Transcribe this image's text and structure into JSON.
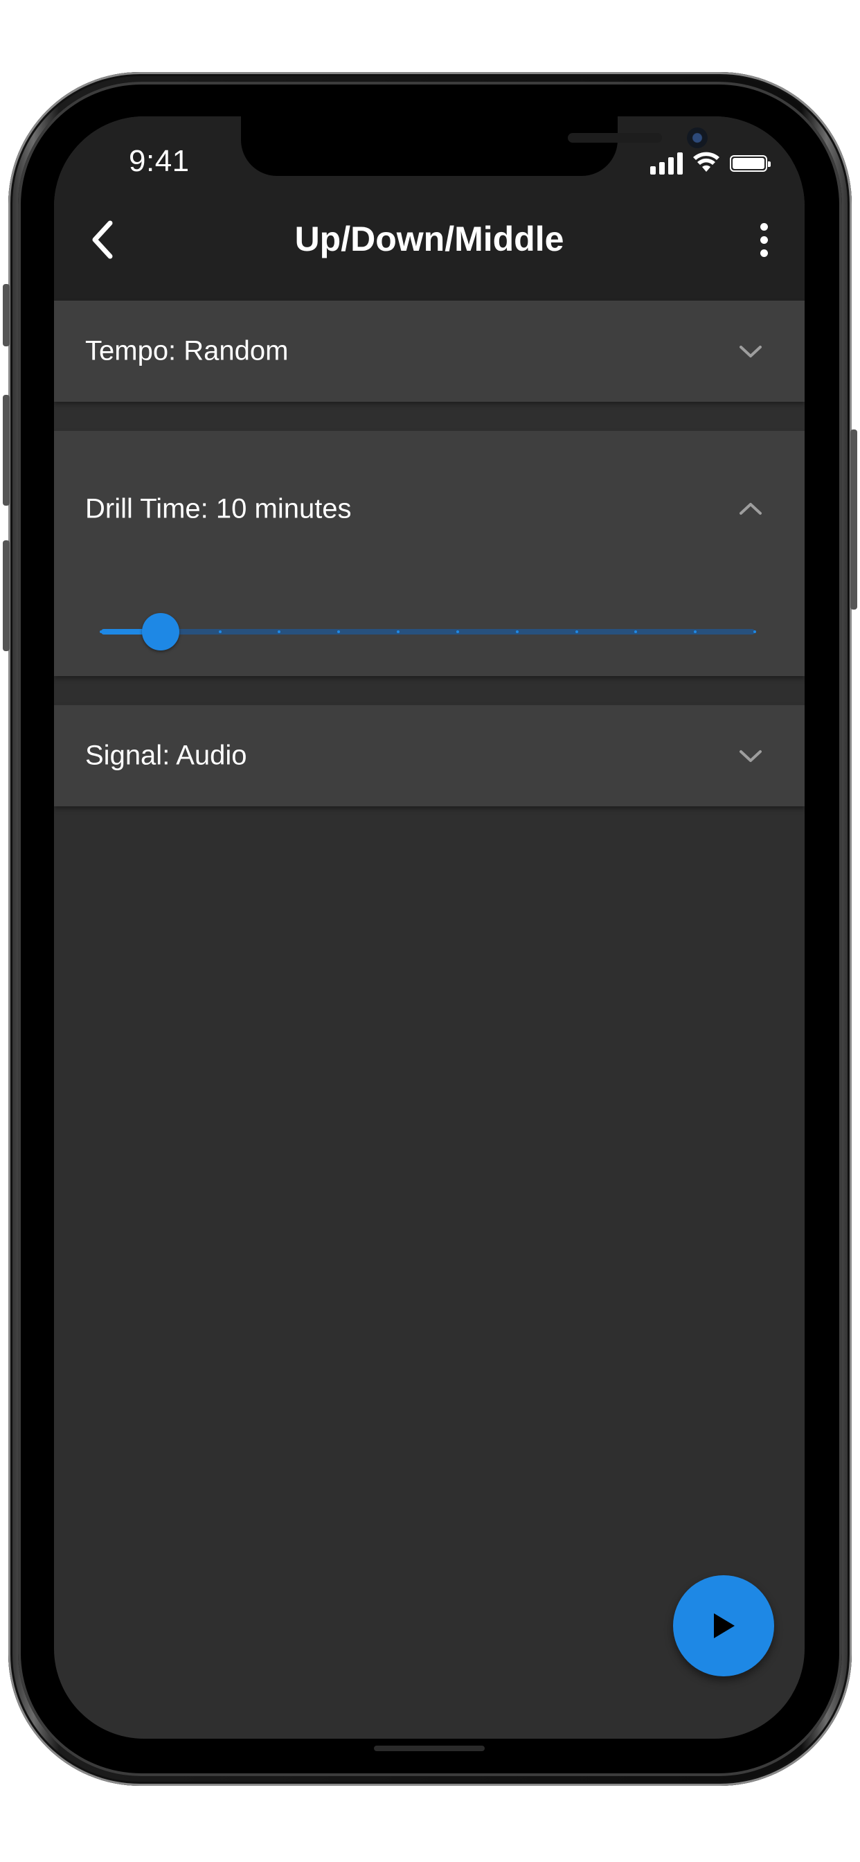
{
  "status_bar": {
    "time": "9:41",
    "signal_icon": "cellular-signal-icon",
    "wifi_icon": "wifi-icon",
    "battery_icon": "battery-icon"
  },
  "nav_bar": {
    "back_icon": "chevron-left-icon",
    "title": "Up/Down/Middle",
    "more_icon": "more-vertical-icon"
  },
  "settings": {
    "tempo": {
      "label": "Tempo: Random",
      "expanded": false,
      "chevron_icon": "chevron-down-icon"
    },
    "drill_time": {
      "label": "Drill Time: 10 minutes",
      "expanded": true,
      "chevron_icon": "chevron-up-icon",
      "slider": {
        "value_index": 1,
        "step_count": 12
      }
    },
    "signal": {
      "label": "Signal: Audio",
      "expanded": false,
      "chevron_icon": "chevron-down-icon"
    }
  },
  "fab": {
    "icon": "play-icon"
  },
  "colors": {
    "accent": "#1e88e5",
    "app_bar": "#212121",
    "background": "#2f2f2f",
    "panel": "#3f3f3f",
    "text": "#ffffff",
    "chevron": "#9e9e9e"
  }
}
